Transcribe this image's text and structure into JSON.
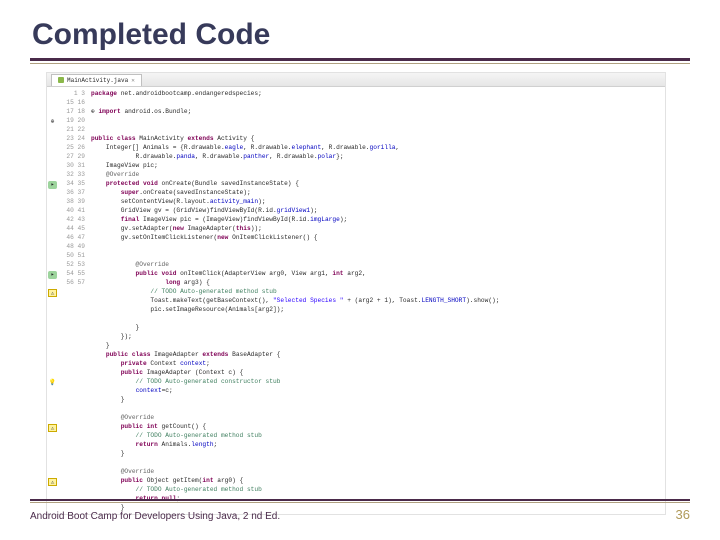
{
  "title": "Completed Code",
  "tab": {
    "filename": "MainActivity.java"
  },
  "footer": {
    "text": "Android Boot Camp for Developers Using Java, 2 nd Ed.",
    "page": "36"
  },
  "code": {
    "start_line": 1,
    "package_kw": "package",
    "package_name": " net.androidbootcamp.endangeredspecies;",
    "import_kw": "import",
    "import_name": " android.os.Bundle;",
    "l16a": "public class",
    "l16b": " MainActivity ",
    "l16c": "extends",
    "l16d": " Activity {",
    "l17a": "    Integer[] Animals = {R.drawable.",
    "l17b": "eagle",
    "l17c": ", R.drawable.",
    "l17d": "elephant",
    "l17e": ", R.drawable.",
    "l17f": "gorilla",
    "l17g": ",",
    "l18a": "            R.drawable.",
    "l18b": "panda",
    "l18c": ", R.drawable.",
    "l18d": "panther",
    "l18e": ", R.drawable.",
    "l18f": "polar",
    "l18g": "};",
    "l19": "    ImageView pic;",
    "l20": "    @Override",
    "l21a": "    protected void",
    "l21b": " onCreate(Bundle savedInstanceState) {",
    "l22a": "        super",
    "l22b": ".onCreate(savedInstanceState);",
    "l23a": "        setContentView(R.layout.",
    "l23b": "activity_main",
    "l23c": ");",
    "l24a": "        GridView gv = (GridView)findViewById(R.id.",
    "l24b": "gridView1",
    "l24c": ");",
    "l25a": "        final",
    "l25b": " ImageView pic = (ImageView)findViewById(R.id.",
    "l25c": "imgLarge",
    "l25d": ");",
    "l26a": "        gv.setAdapter(",
    "l26b": "new",
    "l26c": " ImageAdapter(",
    "l26d": "this",
    "l26e": "));",
    "l27a": "        gv.setOnItemClickListener(",
    "l27b": "new",
    "l27c": " OnItemClickListener() {",
    "l29": "            @Override",
    "l30a": "            public void",
    "l30b": " onItemClick(AdapterView<?> arg0, View arg1, ",
    "l30c": "int",
    "l30d": " arg2,",
    "l31a": "                    long",
    "l31b": " arg3) {",
    "l32": "                // TODO Auto-generated method stub",
    "l33a": "                Toast.makeText(getBaseContext(), ",
    "l33b": "\"Selected Species \"",
    "l33c": " + (arg2 + 1), Toast.",
    "l33d": "LENGTH_SHORT",
    "l33e": ").show();",
    "l34": "                pic.setImageResource(Animals[arg2]);",
    "l36": "            }",
    "l37": "        });",
    "l38": "    }",
    "l39a": "    public class",
    "l39b": " ImageAdapter ",
    "l39c": "extends",
    "l39d": " BaseAdapter {",
    "l40a": "        private",
    "l40b": " Context ",
    "l40c": "context",
    "l40d": ";",
    "l41a": "        public",
    "l41b": " ImageAdapter (Context c) {",
    "l42": "            // TODO Auto-generated constructor stub",
    "l43a": "            context",
    "l43b": "=c;",
    "l44": "        }",
    "l46": "        @Override",
    "l47a": "        public int",
    "l47b": " getCount() {",
    "l48": "            // TODO Auto-generated method stub",
    "l49a": "            return",
    "l49b": " Animals.",
    "l49c": "length",
    "l49d": ";",
    "l50": "        }",
    "l52": "        @Override",
    "l53a": "        public",
    "l53b": " Object getItem(",
    "l53c": "int",
    "l53d": " arg0) {",
    "l54": "            // TODO Auto-generated method stub",
    "l55a": "            return null",
    "l55b": ";",
    "l56": "        }"
  },
  "line_numbers": [
    "1",
    "",
    "3",
    "",
    "15",
    "16",
    "17",
    "18",
    "19",
    "20",
    "21",
    "22",
    "23",
    "24",
    "25",
    "26",
    "27",
    "",
    "",
    "29",
    "30",
    "31",
    "32",
    "33",
    "34",
    "35",
    "36",
    "37",
    "38",
    "39",
    "40",
    "41",
    "42",
    "43",
    "44",
    "45",
    "46",
    "47",
    "48",
    "49",
    "50",
    "51",
    "52",
    "53",
    "54",
    "55",
    "56",
    "57"
  ],
  "markers": [
    {
      "line_idx": 3,
      "cls": "",
      "glyph": "⊕"
    },
    {
      "line_idx": 10,
      "cls": "green",
      "glyph": "▸"
    },
    {
      "line_idx": 20,
      "cls": "green",
      "glyph": "▸"
    },
    {
      "line_idx": 22,
      "cls": "yellow",
      "glyph": "⚠"
    },
    {
      "line_idx": 32,
      "cls": "bulb",
      "glyph": "💡"
    },
    {
      "line_idx": 37,
      "cls": "yellow",
      "glyph": "⚠"
    },
    {
      "line_idx": 43,
      "cls": "yellow",
      "glyph": "⚠"
    }
  ]
}
